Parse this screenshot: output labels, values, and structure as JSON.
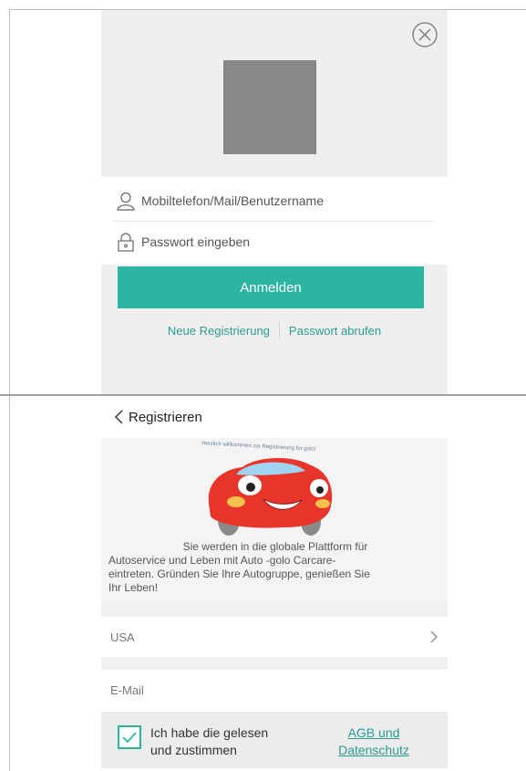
{
  "login": {
    "username_placeholder": "Mobiltelefon/Mail/Benutzername",
    "password_placeholder": "Passwort eingeben",
    "login_button": "Anmelden",
    "register_link": "Neue Registrierung",
    "forgot_link": "Passwort abrufen",
    "accent_color": "#2bb5a2",
    "icons": [
      "close-icon",
      "user-icon",
      "lock-icon"
    ]
  },
  "register": {
    "title": "Registrieren",
    "hero_banner": "Herzlich willkommen zur Registrierung für golo!",
    "hero_text_lines": [
      "Sie werden in die globale Plattform für",
      "Autoservice und Leben mit Auto -golo Carcare-",
      "eintreten. Gründen Sie Ihre Autogruppe, genießen Sie",
      "Ihr Leben!"
    ],
    "country": "USA",
    "email_placeholder": "E-Mail",
    "agree_lines": [
      "Ich habe die gelesen",
      "und zustimmen"
    ],
    "agb_lines": [
      "AGB und",
      "Datenschutz"
    ],
    "agree_checked": true,
    "icons": [
      "back-chevron-icon",
      "chevron-right-icon",
      "checkmark-icon",
      "car-mascot"
    ]
  }
}
